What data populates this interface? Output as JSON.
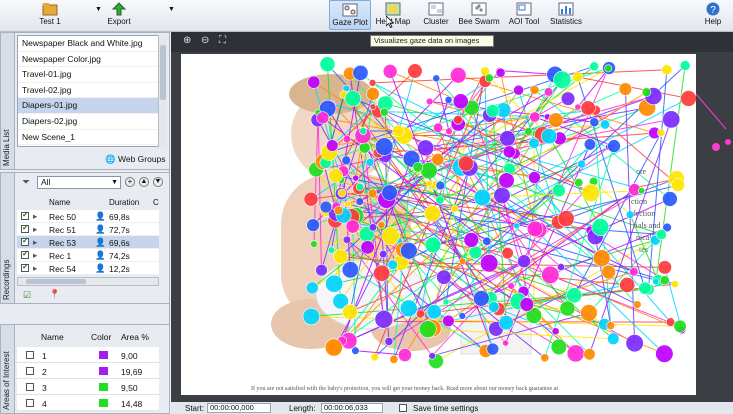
{
  "toolbar": {
    "test_label": "Test 1",
    "export_label": "Export",
    "buttons": [
      {
        "label": "Gaze Plot"
      },
      {
        "label": "Heat Map"
      },
      {
        "label": "Cluster"
      },
      {
        "label": "Bee Swarm"
      },
      {
        "label": "AOI Tool"
      },
      {
        "label": "Statistics"
      }
    ],
    "help_label": "Help",
    "tooltip": "Visualizes gaze data on images"
  },
  "media_list": {
    "tab_label": "Media List",
    "items": [
      {
        "label": "Newspaper Black and White.jpg"
      },
      {
        "label": "Newspaper Color.jpg"
      },
      {
        "label": "Travel-01.jpg"
      },
      {
        "label": "Travel-02.jpg"
      },
      {
        "label": "Diapers-01.jpg"
      },
      {
        "label": "Diapers-02.jpg"
      },
      {
        "label": "New Scene_1"
      }
    ],
    "web_groups_label": "Web Groups"
  },
  "recordings": {
    "tab_label": "Recordings",
    "filter_value": "All",
    "col_name": "Name",
    "col_duration": "Duration",
    "col_extra": "C",
    "rows": [
      {
        "name": "Rec 50",
        "duration": "69,8s"
      },
      {
        "name": "Rec 51",
        "duration": "72,7s"
      },
      {
        "name": "Rec 53",
        "duration": "69,6s"
      },
      {
        "name": "Rec 1",
        "duration": "74,2s"
      },
      {
        "name": "Rec 54",
        "duration": "12,2s"
      }
    ]
  },
  "aoi": {
    "tab_label": "Areas of Interest",
    "col_name": "Name",
    "col_color": "Color",
    "col_area": "Area %",
    "rows": [
      {
        "name": "1",
        "color": "#a020f0",
        "area": "9,00"
      },
      {
        "name": "2",
        "color": "#a020f0",
        "area": "19,69"
      },
      {
        "name": "3",
        "color": "#22dd22",
        "area": "9,50"
      },
      {
        "name": "4",
        "color": "#22dd22",
        "area": "14,48"
      }
    ]
  },
  "stimulus": {
    "side_text": [
      "ore",
      "ction",
      "fection",
      "rials and",
      "nically",
      "tes"
    ],
    "footer_text": "If you are not satisfied with the baby's protection, you will get your money back. Read more about our money back guarantee at"
  },
  "bottom": {
    "start_label": "Start:",
    "start_value": "00:00:00,000",
    "length_label": "Length:",
    "length_value": "00:00:06,033",
    "save_label": "Save time settings"
  }
}
